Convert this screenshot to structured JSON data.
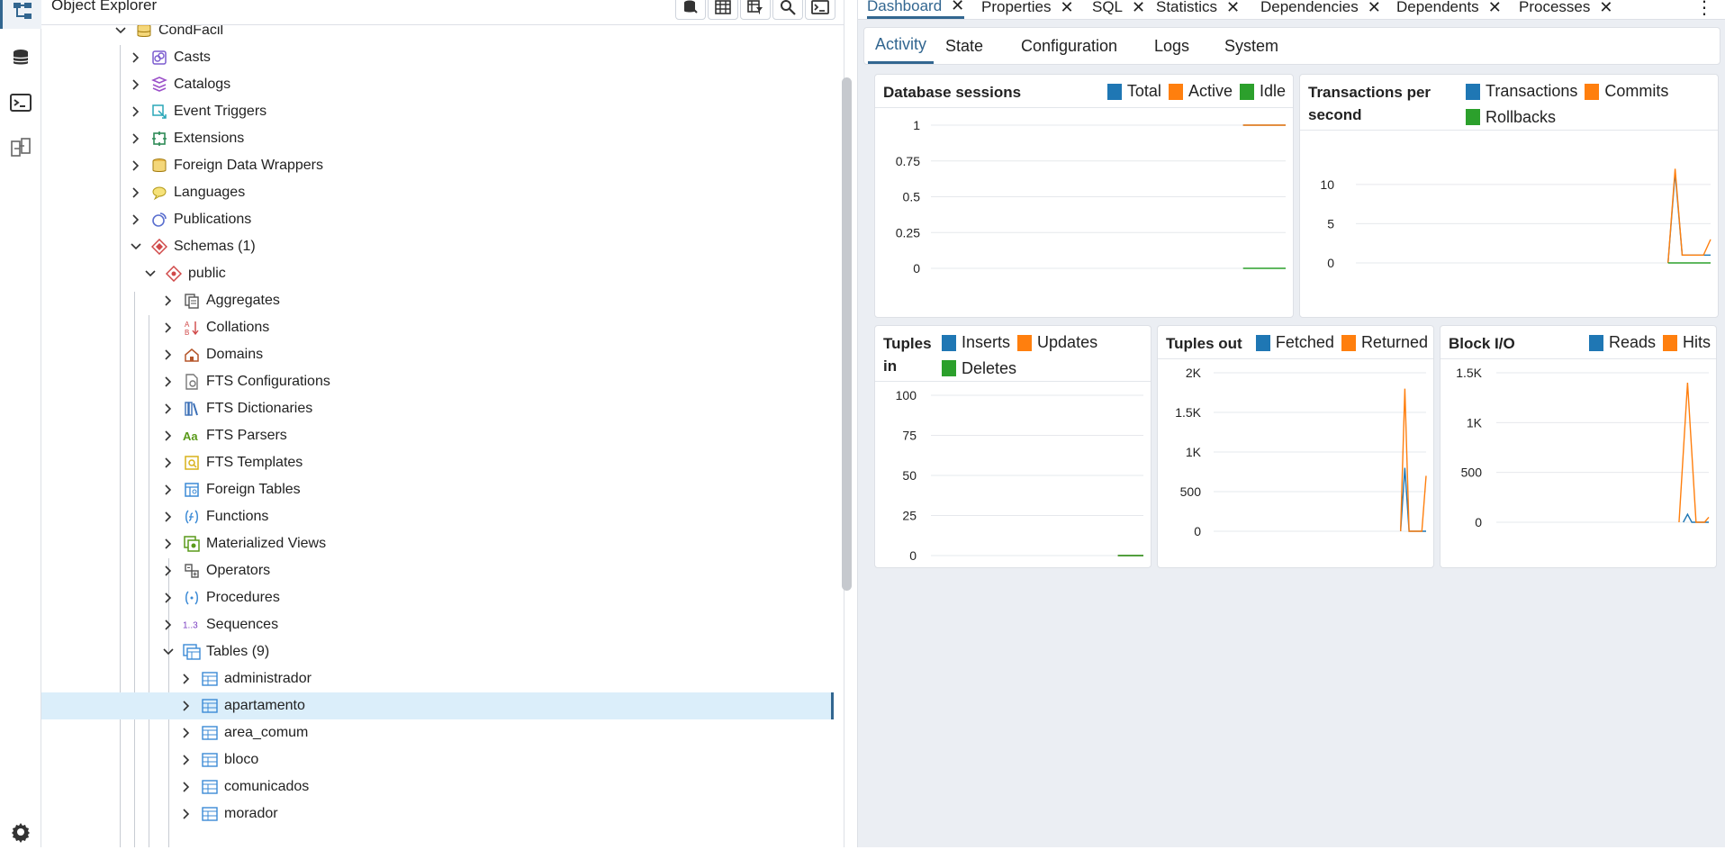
{
  "colors": {
    "accent": "#326690",
    "blue": "#1f77b4",
    "orange": "#ff7f0e",
    "green": "#2ca02c"
  },
  "rail": {
    "items": [
      {
        "icon": "object-explorer-icon",
        "active": true
      },
      {
        "icon": "database-icon"
      },
      {
        "icon": "terminal-icon"
      },
      {
        "icon": "schema-diff-icon"
      }
    ],
    "bottom_icon": "settings-gear-icon"
  },
  "explorer": {
    "title": "Object Explorer",
    "tools": [
      "query-tool-icon",
      "table-view-icon",
      "filter-table-icon",
      "search-icon",
      "psql-tool-icon"
    ],
    "tree": [
      {
        "label": "CondFacil",
        "level": 0,
        "expanded": true,
        "icon": "database-icon"
      },
      {
        "label": "Casts",
        "level": 1,
        "icon": "casts-icon"
      },
      {
        "label": "Catalogs",
        "level": 1,
        "icon": "catalogs-icon"
      },
      {
        "label": "Event Triggers",
        "level": 1,
        "icon": "event-triggers-icon"
      },
      {
        "label": "Extensions",
        "level": 1,
        "icon": "extensions-icon"
      },
      {
        "label": "Foreign Data Wrappers",
        "level": 1,
        "icon": "foreign-data-wrappers-icon"
      },
      {
        "label": "Languages",
        "level": 1,
        "icon": "languages-icon"
      },
      {
        "label": "Publications",
        "level": 1,
        "icon": "publications-icon"
      },
      {
        "label": "Schemas (1)",
        "level": 1,
        "expanded": true,
        "icon": "schemas-icon"
      },
      {
        "label": "public",
        "level": 2,
        "expanded": true,
        "icon": "schema-icon"
      },
      {
        "label": "Aggregates",
        "level": 3,
        "icon": "aggregates-icon"
      },
      {
        "label": "Collations",
        "level": 3,
        "icon": "collations-icon"
      },
      {
        "label": "Domains",
        "level": 3,
        "icon": "domains-icon"
      },
      {
        "label": "FTS Configurations",
        "level": 3,
        "icon": "fts-configurations-icon"
      },
      {
        "label": "FTS Dictionaries",
        "level": 3,
        "icon": "fts-dictionaries-icon"
      },
      {
        "label": "FTS Parsers",
        "level": 3,
        "icon": "fts-parsers-icon"
      },
      {
        "label": "FTS Templates",
        "level": 3,
        "icon": "fts-templates-icon"
      },
      {
        "label": "Foreign Tables",
        "level": 3,
        "icon": "foreign-tables-icon"
      },
      {
        "label": "Functions",
        "level": 3,
        "icon": "functions-icon"
      },
      {
        "label": "Materialized Views",
        "level": 3,
        "icon": "materialized-views-icon"
      },
      {
        "label": "Operators",
        "level": 3,
        "icon": "operators-icon"
      },
      {
        "label": "Procedures",
        "level": 3,
        "icon": "procedures-icon"
      },
      {
        "label": "Sequences",
        "level": 3,
        "icon": "sequences-icon"
      },
      {
        "label": "Tables (9)",
        "level": 3,
        "expanded": true,
        "icon": "tables-icon"
      },
      {
        "label": "administrador",
        "level": 4,
        "icon": "table-icon"
      },
      {
        "label": "apartamento",
        "level": 4,
        "icon": "table-icon",
        "selected": true
      },
      {
        "label": "area_comum",
        "level": 4,
        "icon": "table-icon"
      },
      {
        "label": "bloco",
        "level": 4,
        "icon": "table-icon"
      },
      {
        "label": "comunicados",
        "level": 4,
        "icon": "table-icon"
      },
      {
        "label": "morador",
        "level": 4,
        "icon": "table-icon"
      }
    ]
  },
  "tabs": {
    "items": [
      {
        "label": "Dashboard",
        "active": true
      },
      {
        "label": "Properties"
      },
      {
        "label": "SQL"
      },
      {
        "label": "Statistics"
      },
      {
        "label": "Dependencies"
      },
      {
        "label": "Dependents"
      },
      {
        "label": "Processes"
      }
    ],
    "close_glyph": "✕",
    "more_glyph": "⋮"
  },
  "subtabs": {
    "items": [
      {
        "label": "Activity",
        "active": true
      },
      {
        "label": "State"
      },
      {
        "label": "Configuration"
      },
      {
        "label": "Logs"
      },
      {
        "label": "System"
      }
    ]
  },
  "chart_data": [
    {
      "type": "line",
      "title": "Database sessions",
      "ylim": [
        0,
        1
      ],
      "yticks": [
        "1",
        "0.75",
        "0.5",
        "0.25",
        "0"
      ],
      "series": [
        {
          "name": "Total",
          "color": "#1f77b4",
          "x": [
            0.88,
            1.0
          ],
          "values": [
            1,
            1
          ]
        },
        {
          "name": "Active",
          "color": "#ff7f0e",
          "x": [
            0.88,
            1.0
          ],
          "values": [
            1,
            1
          ]
        },
        {
          "name": "Idle",
          "color": "#2ca02c",
          "x": [
            0.88,
            1.0
          ],
          "values": [
            0,
            0
          ]
        }
      ]
    },
    {
      "type": "line",
      "title": "Transactions per second",
      "ylim": [
        0,
        14
      ],
      "yticks": [
        "10",
        "5",
        "0"
      ],
      "yvals": [
        10,
        5,
        0
      ],
      "series": [
        {
          "name": "Transactions",
          "color": "#1f77b4",
          "x": [
            0.88,
            0.9,
            0.92,
            0.94,
            1.0
          ],
          "values": [
            0,
            11.5,
            1,
            1,
            1
          ]
        },
        {
          "name": "Commits",
          "color": "#ff7f0e",
          "x": [
            0.88,
            0.9,
            0.92,
            0.94,
            0.98,
            1.0
          ],
          "values": [
            0,
            12,
            1,
            1,
            1,
            3
          ]
        },
        {
          "name": "Rollbacks",
          "color": "#2ca02c",
          "x": [
            0.88,
            1.0
          ],
          "values": [
            0,
            0
          ]
        }
      ]
    },
    {
      "type": "line",
      "title": "Tuples in",
      "ylim": [
        0,
        100
      ],
      "yticks": [
        "100",
        "75",
        "50",
        "25",
        "0"
      ],
      "series": [
        {
          "name": "Inserts",
          "color": "#1f77b4",
          "x": [
            0.88,
            1.0
          ],
          "values": [
            0,
            0
          ]
        },
        {
          "name": "Updates",
          "color": "#ff7f0e",
          "x": [
            0.88,
            1.0
          ],
          "values": [
            0,
            0
          ]
        },
        {
          "name": "Deletes",
          "color": "#2ca02c",
          "x": [
            0.88,
            1.0
          ],
          "values": [
            0,
            0
          ]
        }
      ]
    },
    {
      "type": "line",
      "title": "Tuples out",
      "ylim": [
        0,
        2000
      ],
      "yticks": [
        "2K",
        "1.5K",
        "1K",
        "500",
        "0"
      ],
      "series": [
        {
          "name": "Fetched",
          "color": "#1f77b4",
          "x": [
            0.88,
            0.9,
            0.92,
            1.0
          ],
          "values": [
            0,
            800,
            0,
            0
          ]
        },
        {
          "name": "Returned",
          "color": "#ff7f0e",
          "x": [
            0.88,
            0.9,
            0.92,
            0.98,
            1.0
          ],
          "values": [
            0,
            1800,
            0,
            0,
            700
          ]
        }
      ]
    },
    {
      "type": "line",
      "title": "Block I/O",
      "ylim": [
        0,
        1500
      ],
      "yticks": [
        "1.5K",
        "1K",
        "500",
        "0"
      ],
      "series": [
        {
          "name": "Reads",
          "color": "#1f77b4",
          "x": [
            0.88,
            0.9,
            0.92,
            1.0
          ],
          "values": [
            0,
            80,
            0,
            0
          ]
        },
        {
          "name": "Hits",
          "color": "#ff7f0e",
          "x": [
            0.86,
            0.9,
            0.94,
            0.98,
            1.0
          ],
          "values": [
            0,
            1400,
            0,
            0,
            50
          ]
        }
      ]
    }
  ]
}
